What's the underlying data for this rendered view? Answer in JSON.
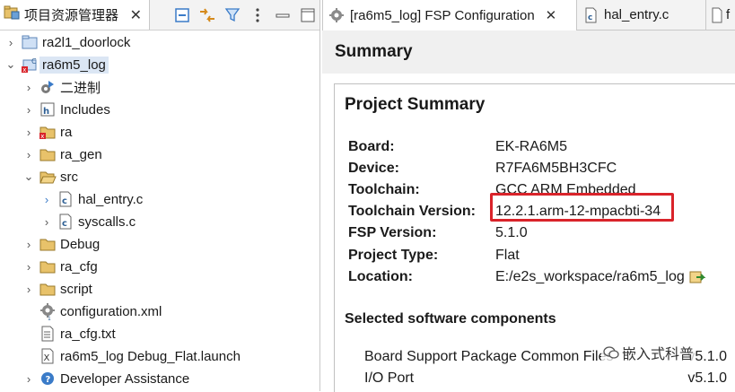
{
  "project_explorer": {
    "title": "项目资源管理器",
    "close": "✕",
    "tree": [
      {
        "label": "ra2l1_doorlock",
        "icon": "folder-project-icon",
        "expander": "›"
      },
      {
        "label": "ra6m5_log",
        "icon": "project-error-icon",
        "expander": "⌄"
      },
      {
        "label": "二进制",
        "icon": "binaries-icon",
        "expander": "›"
      },
      {
        "label": "Includes",
        "icon": "includes-icon",
        "expander": "›"
      },
      {
        "label": "ra",
        "icon": "folder-error-icon",
        "expander": "›"
      },
      {
        "label": "ra_gen",
        "icon": "folder-icon",
        "expander": "›"
      },
      {
        "label": "src",
        "icon": "folder-open-icon",
        "expander": "⌄"
      },
      {
        "label": "hal_entry.c",
        "icon": "c-file-icon",
        "expander": "›"
      },
      {
        "label": "syscalls.c",
        "icon": "c-file-icon",
        "expander": "›"
      },
      {
        "label": "Debug",
        "icon": "folder-icon",
        "expander": "›"
      },
      {
        "label": "ra_cfg",
        "icon": "folder-icon",
        "expander": "›"
      },
      {
        "label": "script",
        "icon": "folder-icon",
        "expander": "›"
      },
      {
        "label": "configuration.xml",
        "icon": "gear-file-icon",
        "expander": ""
      },
      {
        "label": "ra_cfg.txt",
        "icon": "text-file-icon",
        "expander": ""
      },
      {
        "label": "ra6m5_log Debug_Flat.launch",
        "icon": "launch-file-icon",
        "expander": ""
      },
      {
        "label": "Developer Assistance",
        "icon": "assistance-icon",
        "expander": "›"
      }
    ]
  },
  "editor": {
    "tabs": [
      {
        "label": "[ra6m5_log] FSP Configuration",
        "close": "✕"
      },
      {
        "label": "hal_entry.c",
        "close": ""
      },
      {
        "label": "f",
        "close": ""
      }
    ],
    "summary_header": "Summary",
    "project_summary": {
      "title": "Project Summary",
      "items": [
        {
          "key": "Board:",
          "value": "EK-RA6M5"
        },
        {
          "key": "Device:",
          "value": "R7FA6M5BH3CFC"
        },
        {
          "key": "Toolchain:",
          "value": "GCC ARM Embedded"
        },
        {
          "key": "Toolchain Version:",
          "value": "12.2.1.arm-12-mpacbti-34"
        },
        {
          "key": "FSP Version:",
          "value": "5.1.0"
        },
        {
          "key": "Project Type:",
          "value": "Flat"
        },
        {
          "key": "Location:",
          "value": "E:/e2s_workspace/ra6m5_log"
        }
      ]
    },
    "selected_components": {
      "title": "Selected software components",
      "items": [
        {
          "name": "Board Support Package Common Files",
          "version": "v5.1.0"
        },
        {
          "name": "I/O Port",
          "version": "v5.1.0"
        }
      ]
    },
    "highlight_color": "#d9232a"
  },
  "watermark": {
    "text": "嵌入式科普"
  }
}
